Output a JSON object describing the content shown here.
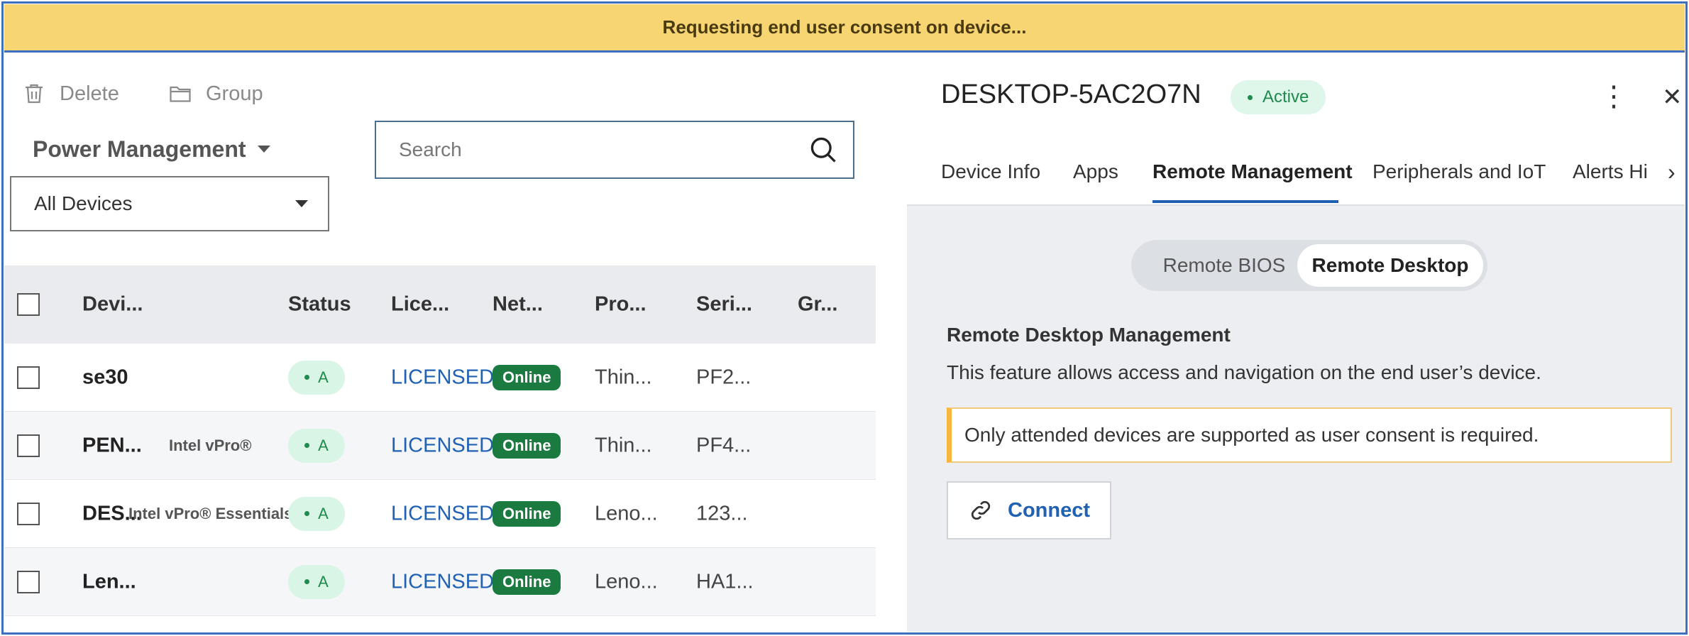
{
  "banner": {
    "text": "Requesting end user consent on device..."
  },
  "toolbar": {
    "delete_label": "Delete",
    "group_label": "Group"
  },
  "filters": {
    "view_label": "Power Management",
    "device_filter": "All Devices"
  },
  "search": {
    "placeholder": "Search"
  },
  "table": {
    "headers": [
      "Devi...",
      "Status",
      "Lice...",
      "Net...",
      "Pro...",
      "Seri...",
      "Gr..."
    ],
    "rows": [
      {
        "name": "se30",
        "tag": "",
        "status": "A",
        "license": "LICENSED",
        "network": "Online",
        "product": "Thin...",
        "serial": "PF2...",
        "group": ""
      },
      {
        "name": "PEN...",
        "tag": "Intel vPro®",
        "status": "A",
        "license": "LICENSED",
        "network": "Online",
        "product": "Thin...",
        "serial": "PF4...",
        "group": ""
      },
      {
        "name": "DES...",
        "tag": "Intel vPro® Essentials",
        "status": "A",
        "license": "LICENSED",
        "network": "Online",
        "product": "Leno...",
        "serial": "123...",
        "group": ""
      },
      {
        "name": "Len...",
        "tag": "",
        "status": "A",
        "license": "LICENSED",
        "network": "Online",
        "product": "Leno...",
        "serial": "HA1...",
        "group": ""
      }
    ]
  },
  "detail": {
    "device_name": "DESKTOP-5AC2O7N",
    "status": "Active",
    "tabs": [
      "Device Info",
      "Apps",
      "Remote Management",
      "Peripherals and IoT",
      "Alerts Hi"
    ],
    "active_tab": "Remote Management",
    "toggle": {
      "bios": "Remote BIOS",
      "desktop": "Remote Desktop",
      "selected": "Remote Desktop"
    },
    "section_title": "Remote Desktop Management",
    "section_desc": "This feature allows access and navigation on the end user’s device.",
    "note": "Only attended devices are supported as user consent is required.",
    "connect_label": "Connect"
  },
  "colors": {
    "banner": "#f7d573",
    "accent": "#2061b4",
    "online": "#1b7a3f",
    "active_bg": "#dff6ea"
  }
}
